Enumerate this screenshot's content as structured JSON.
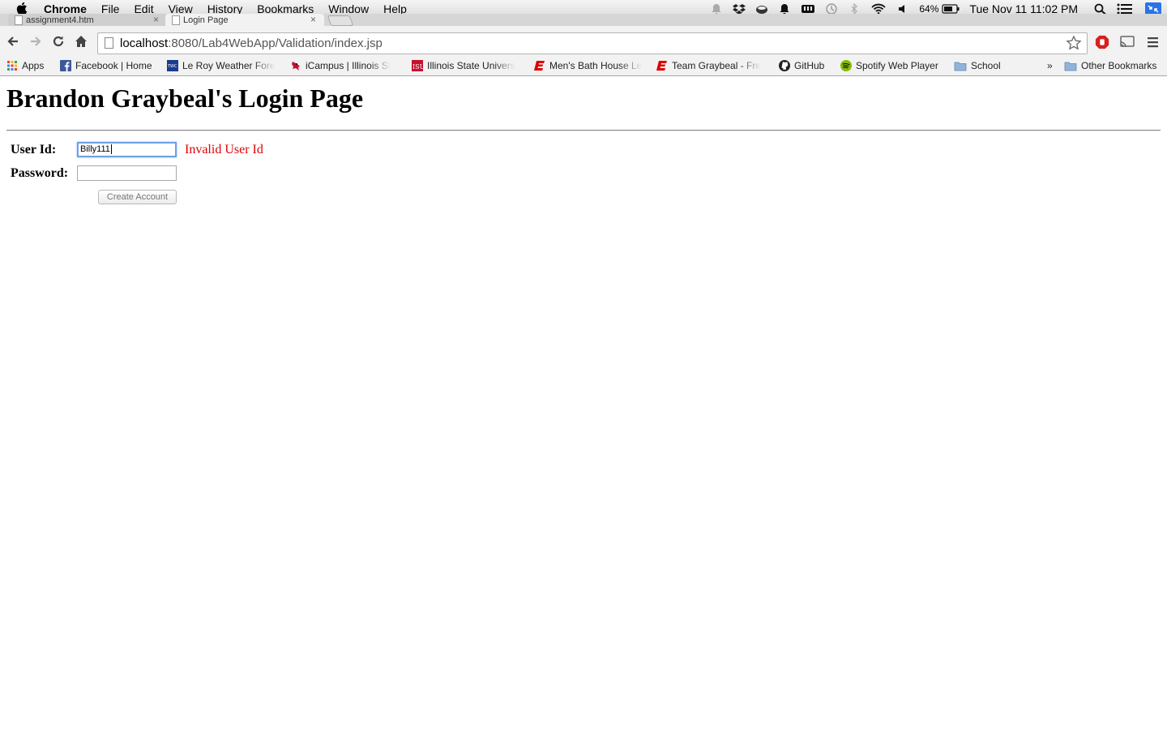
{
  "menubar": {
    "app_name": "Chrome",
    "items": [
      "File",
      "Edit",
      "View",
      "History",
      "Bookmarks",
      "Window",
      "Help"
    ],
    "battery_percent": "64%",
    "clock": "Tue Nov 11  11:02 PM"
  },
  "tabs": [
    {
      "title": "assignment4.htm",
      "active": false
    },
    {
      "title": "Login Page",
      "active": true
    }
  ],
  "toolbar": {
    "url_host": "localhost",
    "url_rest": ":8080/Lab4WebApp/Validation/index.jsp"
  },
  "bookmarks": {
    "items": [
      {
        "label": "Apps",
        "icon": "apps-grid-icon"
      },
      {
        "label": "Facebook | Home",
        "icon": "facebook-icon"
      },
      {
        "label": "Le Roy Weather Fore",
        "icon": "twc-icon"
      },
      {
        "label": "iCampus | Illinois St",
        "icon": "cardinal-icon"
      },
      {
        "label": "Illinois State Univers",
        "icon": "isu-icon"
      },
      {
        "label": "Men's Bath House Le",
        "icon": "espn-icon"
      },
      {
        "label": "Team Graybeal - Fre",
        "icon": "espn-icon"
      },
      {
        "label": "GitHub",
        "icon": "github-icon"
      },
      {
        "label": "Spotify Web Player",
        "icon": "spotify-icon"
      },
      {
        "label": "School",
        "icon": "folder-icon"
      }
    ],
    "overflow": "»",
    "other": "Other Bookmarks"
  },
  "page": {
    "heading": "Brandon Graybeal's Login Page",
    "user_id_label": "User Id:",
    "user_id_value": "Billy111",
    "user_id_error": "Invalid User Id",
    "password_label": "Password:",
    "password_value": "",
    "create_button": "Create Account"
  },
  "colors": {
    "error": "#e00000",
    "focus_ring": "#6fa0e6"
  }
}
